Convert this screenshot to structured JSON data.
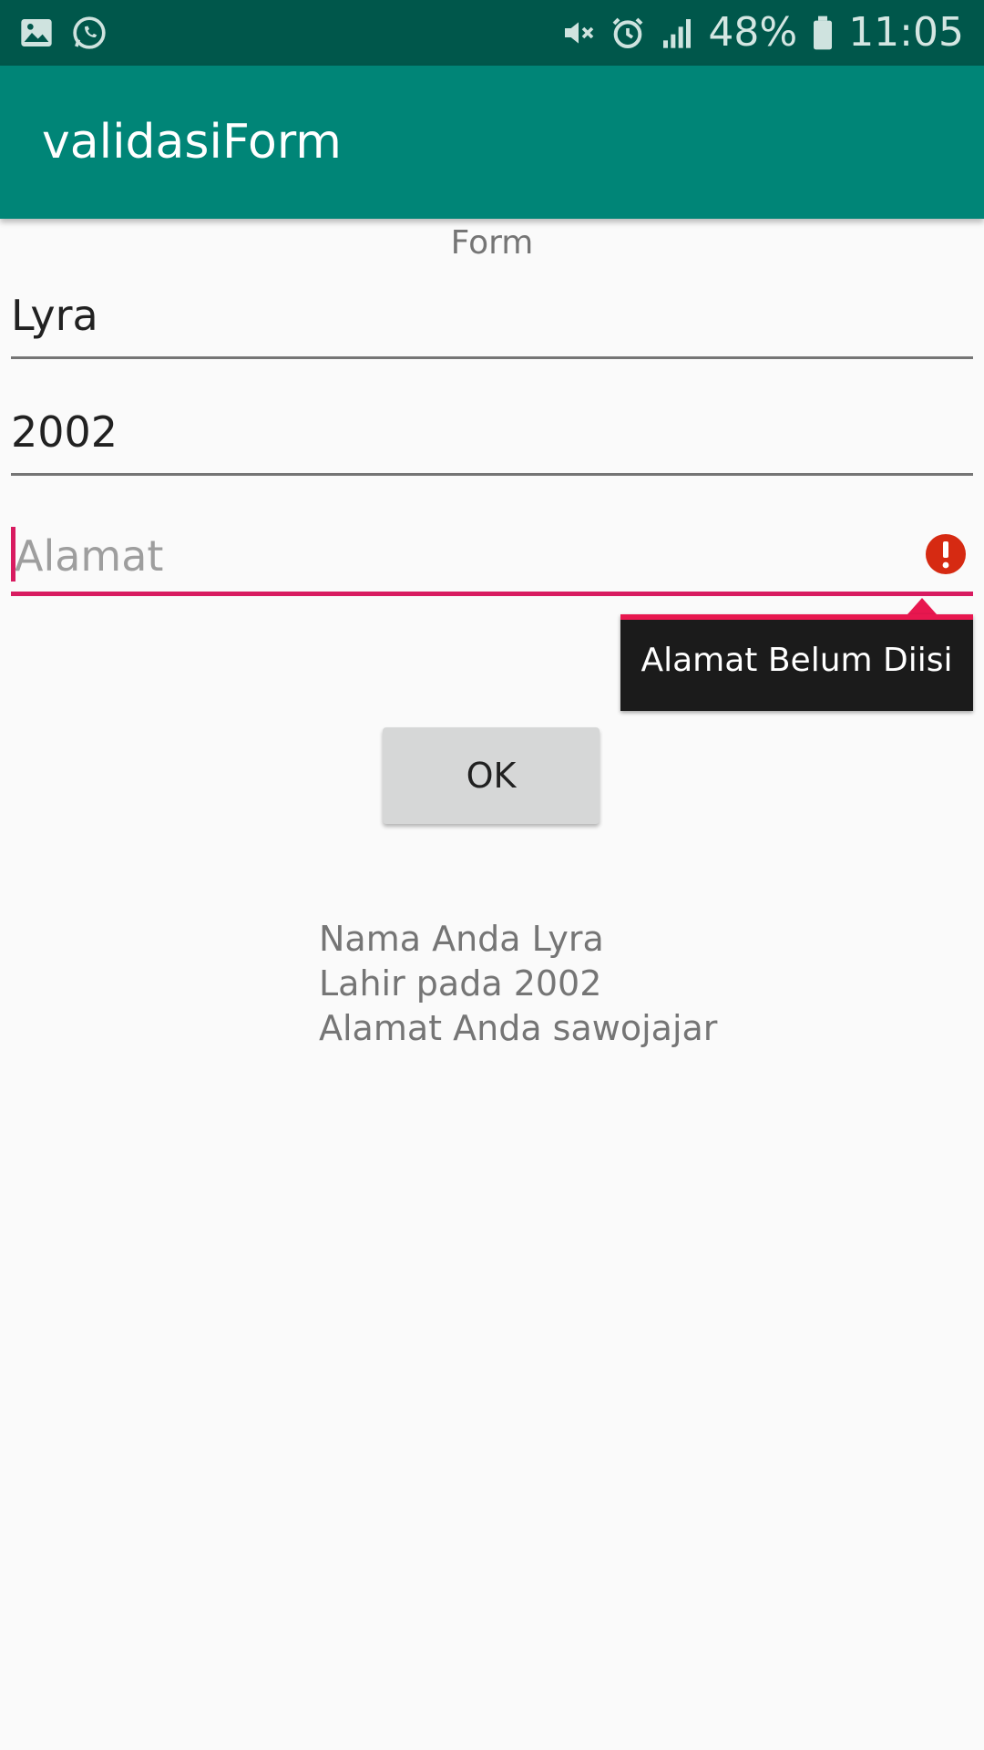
{
  "status_bar": {
    "left_icons": [
      "image-icon",
      "whatsapp-icon"
    ],
    "right_icons": [
      "mute-icon",
      "alarm-icon",
      "signal-icon",
      "battery-icon"
    ],
    "battery": "48%",
    "time": "11:05"
  },
  "app_bar": {
    "title": "validasiForm"
  },
  "form": {
    "heading": "Form",
    "nama_value": "Lyra",
    "tahun_value": "2002",
    "alamat_placeholder": "Alamat",
    "alamat_error": "Alamat Belum Diisi",
    "ok_label": "OK"
  },
  "result": {
    "line1": "Nama Anda Lyra",
    "line2": "Lahir pada 2002",
    "line3": "Alamat Anda sawojajar"
  },
  "colors": {
    "status_bar": "#00574b",
    "app_bar": "#008577",
    "accent": "#d81b60",
    "error_icon": "#d32f2f"
  }
}
